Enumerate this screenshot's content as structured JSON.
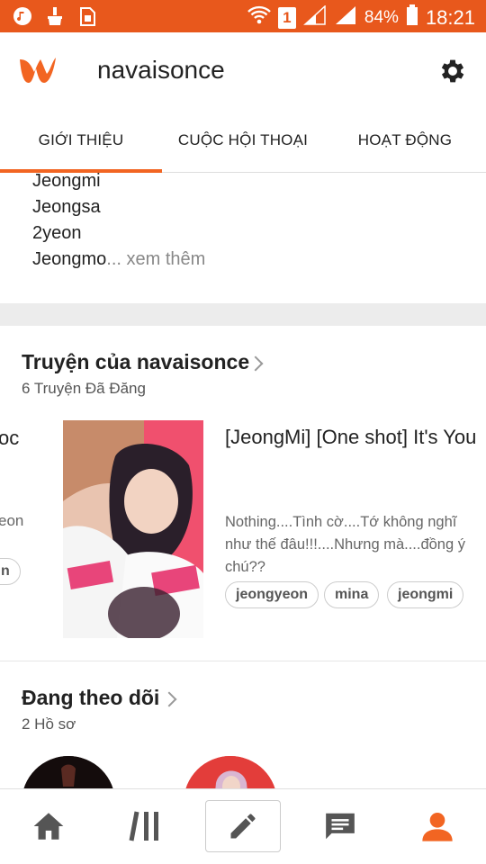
{
  "status_bar": {
    "battery": "84%",
    "time": "18:21",
    "sim": "1"
  },
  "header": {
    "username": "navaisonce",
    "logo_icon": "wattpad-logo",
    "settings_icon": "gear-icon"
  },
  "tabs": [
    {
      "label": "GIỚI THIỆU",
      "active": true
    },
    {
      "label": "CUỘC HỘI THOẠI",
      "active": false
    },
    {
      "label": "HOẠT ĐỘNG",
      "active": false
    }
  ],
  "about": {
    "lines": [
      "Jeongmi",
      "Jeongsa",
      "2yeon"
    ],
    "last_line": "Jeongmo",
    "see_more": "... xem thêm"
  },
  "stories": {
    "title": "Truyện của navaisonce",
    "subtitle": "6 Truyện Đã Đăng",
    "partial_prev": {
      "title_fragment": "oc",
      "desc_fragment": "eon",
      "tag_fragment": "n"
    },
    "card": {
      "title": "[JeongMi] [One shot] It's You",
      "description": "Nothing....Tình cờ....Tớ không nghĩ như thế đâu!!!....Nhưng mà....đồng ý chú??",
      "tags": [
        "jeongyeon",
        "mina",
        "jeongmi"
      ]
    }
  },
  "following": {
    "title": "Đang theo dõi",
    "subtitle": "2 Hồ sơ"
  },
  "colors": {
    "accent": "#f26522",
    "status_bar": "#e8581c"
  },
  "bottom_nav": [
    "home-icon",
    "library-icon",
    "write-icon",
    "messages-icon",
    "profile-icon"
  ]
}
